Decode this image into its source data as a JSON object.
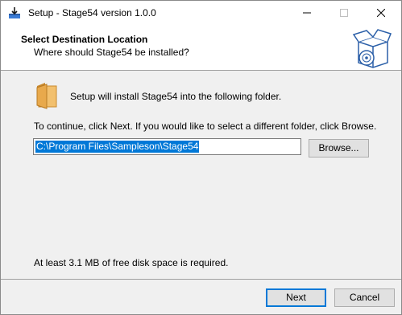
{
  "window": {
    "title": "Setup - Stage54 version 1.0.0",
    "controls": {
      "minimize": "–",
      "maximize": "☐",
      "close": "✕"
    }
  },
  "header": {
    "title": "Select Destination Location",
    "subtitle": "Where should Stage54 be installed?"
  },
  "body": {
    "intro": "Setup will install Stage54 into the following folder.",
    "instruction": "To continue, click Next. If you would like to select a different folder, click Browse.",
    "path_value": "C:\\Program Files\\Sampleson\\Stage54",
    "browse_label": "Browse...",
    "disk_space": "At least 3.1 MB of free disk space is required."
  },
  "footer": {
    "next_label": "Next",
    "cancel_label": "Cancel"
  },
  "colors": {
    "selection": "#0078d7",
    "folder": "#e8a94c",
    "focus_border": "#0078d7"
  },
  "icons": [
    "setup-app-icon",
    "install-box-icon",
    "folder-icon"
  ]
}
